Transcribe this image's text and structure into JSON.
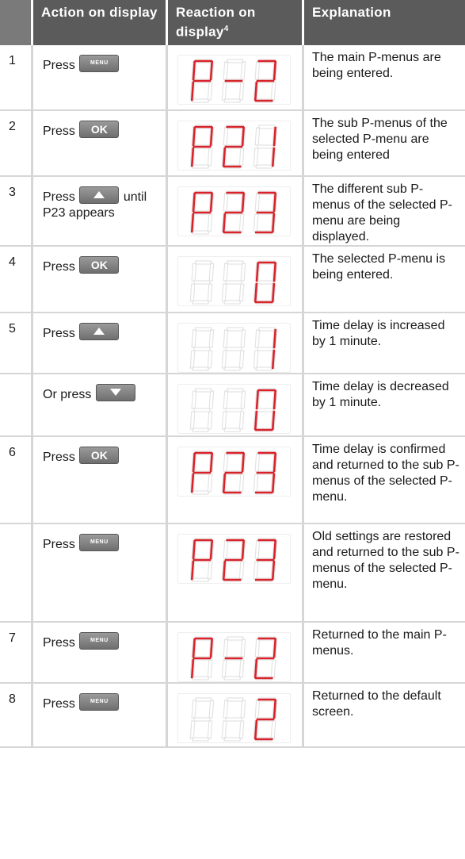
{
  "header": {
    "step": "",
    "action": "Action on display",
    "reaction": "Reaction on display",
    "reaction_note": "4",
    "explanation": "Explanation"
  },
  "rows": [
    {
      "step": "1",
      "press": "Press",
      "button": "MENU",
      "after": "",
      "display": "P-2",
      "explanation": "The main P-menus are being entered."
    },
    {
      "step": "2",
      "press": "Press",
      "button": "OK",
      "after": "",
      "display": "P21",
      "explanation": "The sub P-menus of the selected P-menu are being entered"
    },
    {
      "step": "3",
      "press": "Press",
      "button": "up-arrow",
      "after": "until",
      "after2": "P23 appears",
      "display": "P23",
      "explanation": "The different sub P-menus of the selected P-menu are being displayed."
    },
    {
      "step": "4",
      "press": "Press",
      "button": "OK",
      "after": "",
      "display": "0",
      "explanation": "The selected P-menu is being entered."
    },
    {
      "step": "5",
      "press": "Press",
      "button": "up-arrow",
      "after": "",
      "display": "1",
      "explanation": "Time delay is increased by 1 minute."
    },
    {
      "step": "",
      "press": "Or press",
      "button": "down-arrow",
      "after": "",
      "display": "0",
      "explanation": "Time delay is decreased by 1 minute."
    },
    {
      "step": "6",
      "press": "Press",
      "button": "OK",
      "after": "",
      "display": "P23",
      "explanation": "Time delay is confirmed and returned to the sub P-menus of the selected P-menu."
    },
    {
      "step": "",
      "press": "Press",
      "button": "MENU",
      "after": "",
      "display": "P23",
      "explanation": "Old settings are restored and returned to the sub P-menus of the selected P-menu."
    },
    {
      "step": "7",
      "press": "Press",
      "button": "MENU",
      "after": "",
      "display": "P-2",
      "explanation": "Returned to the main P-menus."
    },
    {
      "step": "8",
      "press": "Press",
      "button": "MENU",
      "after": "",
      "display": "2",
      "explanation": "Returned to the default screen."
    }
  ],
  "colors": {
    "header_bg": "#5b5b5b",
    "segment_on": "#d8232a",
    "segment_off": "#e3e3e3",
    "grid": "#d6d6d6"
  }
}
